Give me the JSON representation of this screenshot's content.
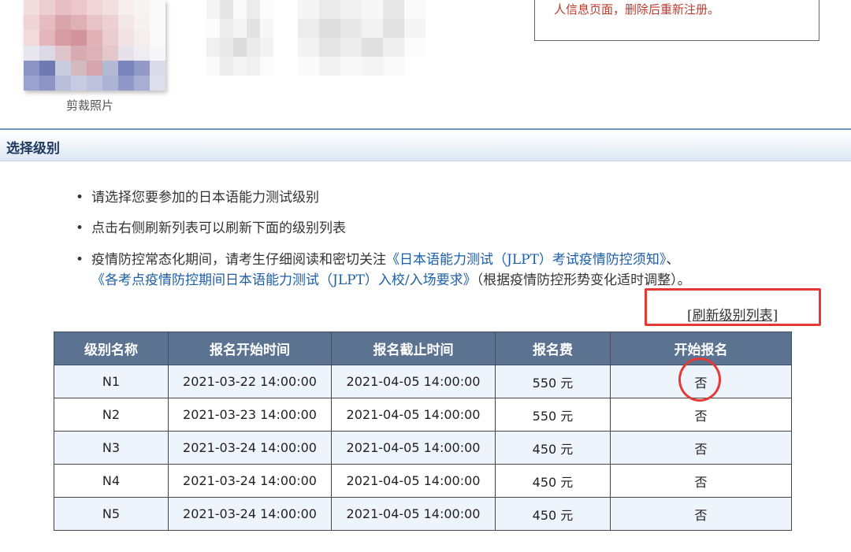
{
  "photo": {
    "caption": "剪裁照片",
    "pixels": [
      "#f1dede",
      "#eccfd2",
      "#e6bfc4",
      "#edc6cb",
      "#f0d4d6",
      "#f2dfe0",
      "#f6eeee",
      "#f8f4f4",
      "#fbfafa",
      "#eed4d6",
      "#e6bcc1",
      "#d9a4ab",
      "#dfb0b5",
      "#e7c2c6",
      "#ecd0d2",
      "#f3e6e6",
      "#f7f1f1",
      "#fbfafa",
      "#f0dadb",
      "#e3b6bb",
      "#d69ba3",
      "#d2939b",
      "#e0b2b7",
      "#ebcdd0",
      "#f2e2e3",
      "#f6eeee",
      "#fbfafa",
      "#e8e6ee",
      "#dcd9e6",
      "#e0c4cb",
      "#d8aab1",
      "#dcb2b8",
      "#e4c7cb",
      "#e7e2ea",
      "#eeedf2",
      "#f7f7f9",
      "#8b93c3",
      "#6f7ab4",
      "#c9cbe0",
      "#d3b9c0",
      "#d6a4ab",
      "#b4b9d6",
      "#7984bb",
      "#929ac7",
      "#d9dbe9",
      "#9aa2ce",
      "#8c95c6",
      "#b9bedb",
      "#c8cbe1",
      "#bec2dc",
      "#aeb3d5",
      "#8f98c8",
      "#a7aed3",
      "#dcdeeb"
    ]
  },
  "blur_left": {
    "pixels": [
      "#f4f4f4",
      "#e6e6e6",
      "#fafafa",
      "#ececec",
      "#fbfbfb",
      "#fcfcfc",
      "#ececec",
      "#f5f5f5",
      "#e2e2e2",
      "#f7f7f7",
      "#f0f0f0",
      "#e9e9e9",
      "#dcdcdc",
      "#eaeaea",
      "#f3f3f3",
      "#fafafa",
      "#ededed",
      "#f4f4f4",
      "#f0f0f0",
      "#fbfbfb"
    ]
  },
  "blur_right": {
    "pixels": [
      "#f5f5f5",
      "#eaeaea",
      "#f0f0f0",
      "#f7f7f7",
      "#e8e8e8",
      "#fafafa",
      "#ececec",
      "#dedede",
      "#e8e8e8",
      "#f2f2f2",
      "#e2e2e2",
      "#f5f5f5",
      "#f3f3f3",
      "#e5e5e5",
      "#ededed",
      "#e0e0e0",
      "#efefef",
      "#fbfbfb",
      "#fafafa",
      "#f2f2f2",
      "#f8f8f8",
      "#f4f4f4",
      "#f9f9f9",
      "#ffffff"
    ]
  },
  "notice": {
    "text": "人信息页面，删除后重新注册。"
  },
  "section": {
    "title": "选择级别"
  },
  "instructions": {
    "item1": "请选择您要参加的日本语能力测试级别",
    "item2": "点击右侧刷新列表可以刷新下面的级别列表",
    "item3_prefix": "疫情防控常态化期间，请考生仔细阅读和密切关注",
    "item3_link1": "《日本语能力测试（JLPT）考试疫情防控须知》",
    "item3_sep": "、",
    "item3_link2": "《各考点疫情防控期间日本语能力测试（JLPT）入校/入场要求》",
    "item3_suffix": "（根据疫情防控形势变化适时调整）。"
  },
  "refresh_link": "[刷新级别列表]",
  "table": {
    "headers": [
      "级别名称",
      "报名开始时间",
      "报名截止时间",
      "报名费",
      "开始报名"
    ],
    "rows": [
      [
        "N1",
        "2021-03-22 14:00:00",
        "2021-04-05 14:00:00",
        "550 元",
        "否"
      ],
      [
        "N2",
        "2021-03-23 14:00:00",
        "2021-04-05 14:00:00",
        "550 元",
        "否"
      ],
      [
        "N3",
        "2021-03-24 14:00:00",
        "2021-04-05 14:00:00",
        "450 元",
        "否"
      ],
      [
        "N4",
        "2021-03-24 14:00:00",
        "2021-04-05 14:00:00",
        "450 元",
        "否"
      ],
      [
        "N5",
        "2021-03-24 14:00:00",
        "2021-04-05 14:00:00",
        "450 元",
        "否"
      ]
    ]
  },
  "colors": {
    "header_bg": "#5b7291",
    "link": "#1d5ea8",
    "annotation": "#e53935",
    "notice_text": "#c0392b"
  }
}
